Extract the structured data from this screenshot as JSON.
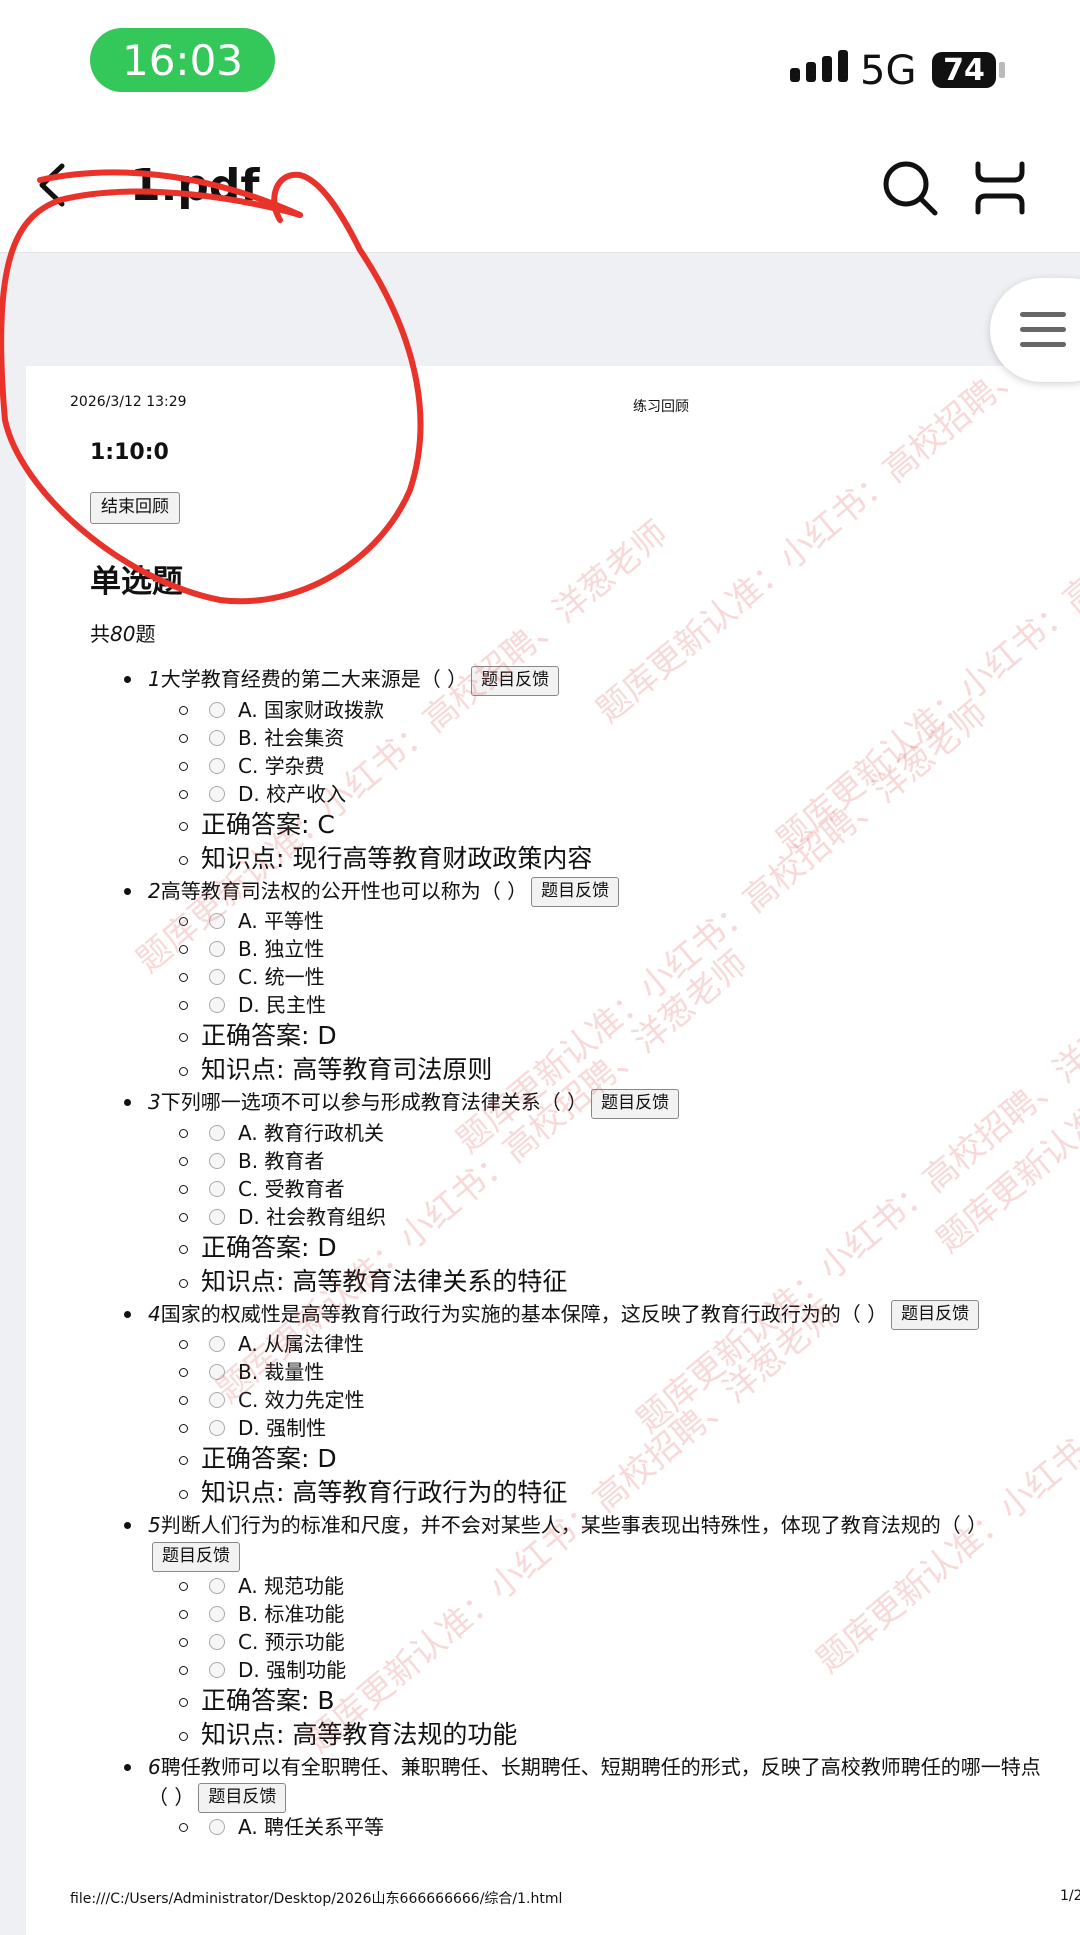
{
  "status": {
    "time": "16:03",
    "network": "5G",
    "battery": "74"
  },
  "nav": {
    "title": "1.pdf"
  },
  "doc": {
    "date": "2026/3/12 13:29",
    "header_title": "练习回顾",
    "timer": "1:10:0",
    "end_button": "结束回顾",
    "section_title": "单选题",
    "count_prefix": "共",
    "count_num": "80",
    "count_suffix": "题",
    "feedback_label": "题目反馈",
    "answer_label": "正确答案: ",
    "knowledge_label": "知识点: ",
    "questions": [
      {
        "num": "1",
        "text": "大学教育经费的第二大来源是（ ）",
        "options": [
          "A. 国家财政拨款",
          "B. 社会集资",
          "C. 学杂费",
          "D. 校产收入"
        ],
        "answer": "C",
        "knowledge": "现行高等教育财政政策内容"
      },
      {
        "num": "2",
        "text": "高等教育司法权的公开性也可以称为（ ）",
        "options": [
          "A. 平等性",
          "B. 独立性",
          "C. 统一性",
          "D. 民主性"
        ],
        "answer": "D",
        "knowledge": "高等教育司法原则"
      },
      {
        "num": "3",
        "text": "下列哪一选项不可以参与形成教育法律关系（ ）",
        "options": [
          "A. 教育行政机关",
          "B. 教育者",
          "C. 受教育者",
          "D. 社会教育组织"
        ],
        "answer": "D",
        "knowledge": "高等教育法律关系的特征"
      },
      {
        "num": "4",
        "text": "国家的权威性是高等教育行政行为实施的基本保障，这反映了教育行政行为的（ ）",
        "options": [
          "A. 从属法律性",
          "B. 裁量性",
          "C. 效力先定性",
          "D. 强制性"
        ],
        "answer": "D",
        "knowledge": "高等教育行政行为的特征"
      },
      {
        "num": "5",
        "text": "判断人们行为的标准和尺度，并不会对某些人，某些事表现出特殊性，体现了教育法规的（ ）",
        "options": [
          "A. 规范功能",
          "B. 标准功能",
          "C. 预示功能",
          "D. 强制功能"
        ],
        "answer": "B",
        "knowledge": "高等教育法规的功能"
      },
      {
        "num": "6",
        "text": "聘任教师可以有全职聘任、兼职聘任、长期聘任、短期聘任的形式，反映了高校教师聘任的哪一特点（ ）",
        "options": [
          "A. 聘任关系平等"
        ],
        "answer": null,
        "knowledge": null
      }
    ],
    "footer_path": "file:///C:/Users/Administrator/Desktop/2026山东666666666/综合/1.html",
    "footer_page": "1/2"
  },
  "watermark": "题库更新认准：小红书：高校招聘、洋葱老师",
  "colors": {
    "time_pill": "#34c759",
    "scribble": "#e8322a",
    "watermark": "#dc5050"
  },
  "icons": {
    "back": "chevron-left-icon",
    "search": "search-icon",
    "fold": "fold-icon",
    "menu": "hamburger-menu-icon"
  }
}
